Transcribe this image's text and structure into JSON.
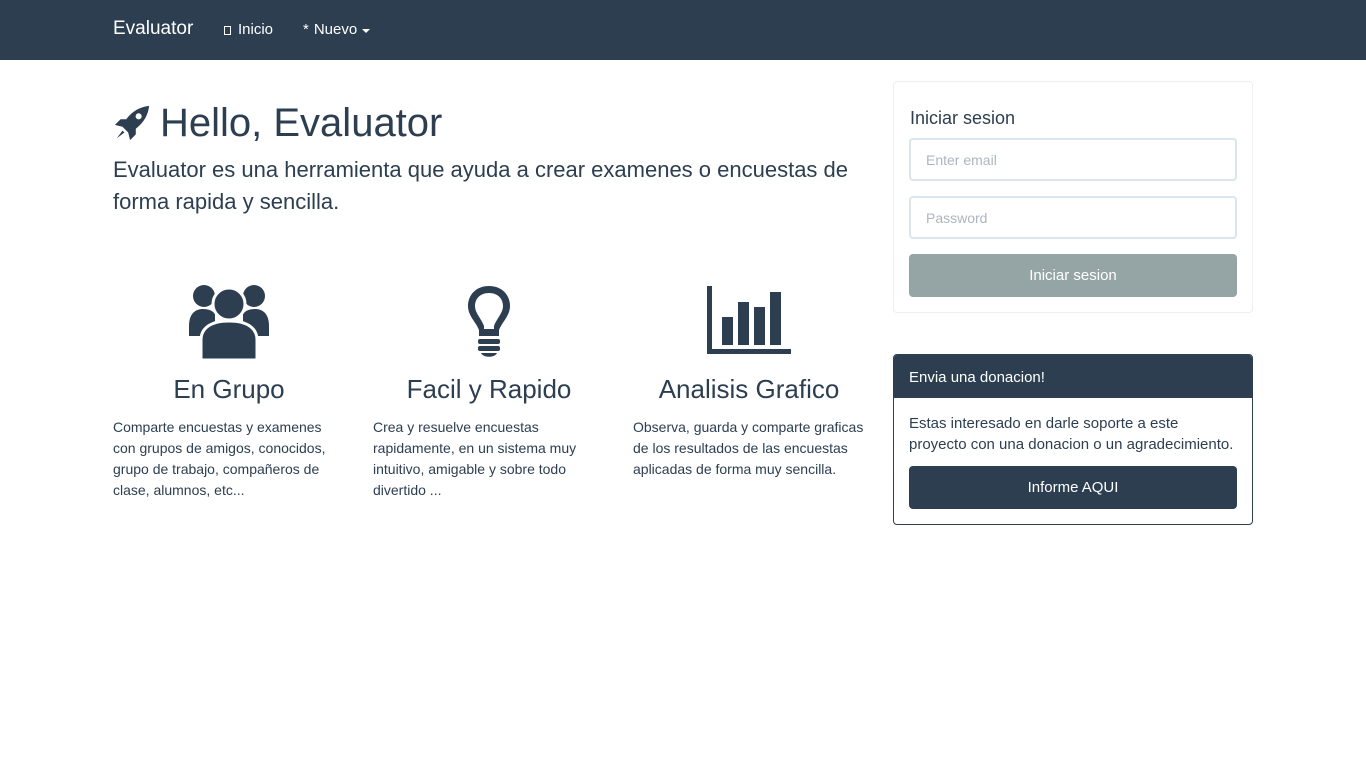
{
  "navbar": {
    "brand": "Evaluator",
    "home_label": "Inicio",
    "new_label": "Nuevo",
    "new_prefix": "*"
  },
  "jumbotron": {
    "title": "Hello, Evaluator",
    "lead": "Evaluator es una herramienta que ayuda a crear examenes o encuestas de forma rapida y sencilla."
  },
  "features": [
    {
      "icon": "users-group-icon",
      "title": "En Grupo",
      "text": "Comparte encuestas y examenes con grupos de amigos, conocidos, grupo de trabajo, compañeros de clase, alumnos, etc..."
    },
    {
      "icon": "lightbulb-icon",
      "title": "Facil y Rapido",
      "text": "Crea y resuelve encuestas rapidamente, en un sistema muy intuitivo, amigable y sobre todo divertido ..."
    },
    {
      "icon": "bar-chart-icon",
      "title": "Analisis Grafico",
      "text": "Observa, guarda y comparte graficas de los resultados de las encuestas aplicadas de forma muy sencilla."
    }
  ],
  "login": {
    "title": "Iniciar sesion",
    "email_placeholder": "Enter email",
    "password_placeholder": "Password",
    "submit_label": "Iniciar sesion"
  },
  "donation": {
    "heading": "Envia una donacion!",
    "text": "Estas interesado en darle soporte a este proyecto con una donacion o un agradecimiento.",
    "button_label": "Informe AQUI"
  },
  "colors": {
    "primary": "#2c3e50",
    "muted_button": "#95a5a6",
    "input_border": "#dce4ec"
  }
}
